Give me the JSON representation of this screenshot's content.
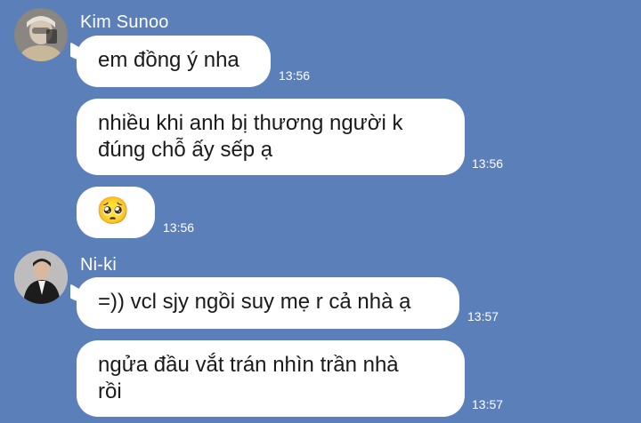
{
  "colors": {
    "background": "#5b7fb8",
    "bubble": "#ffffff",
    "text": "#1a1a1a"
  },
  "messages": [
    {
      "sender": "Kim Sunoo",
      "avatar": "profile-photo",
      "items": [
        {
          "text": "em đồng ý nha",
          "time": "13:56"
        },
        {
          "text_lines": [
            "nhiều khi anh bị thương người k",
            "đúng chỗ ấy sếp ạ"
          ],
          "time": "13:56"
        },
        {
          "text": "🥺",
          "time": "13:56"
        }
      ]
    },
    {
      "sender": "Ni-ki",
      "avatar": "profile-photo",
      "items": [
        {
          "text": "=)) vcl sjy ngồi suy mẹ r cả nhà ạ",
          "time": "13:57"
        },
        {
          "text_lines": [
            "ngửa đầu vắt trán nhìn trần nhà",
            "rồi"
          ],
          "time": "13:57"
        }
      ]
    }
  ]
}
